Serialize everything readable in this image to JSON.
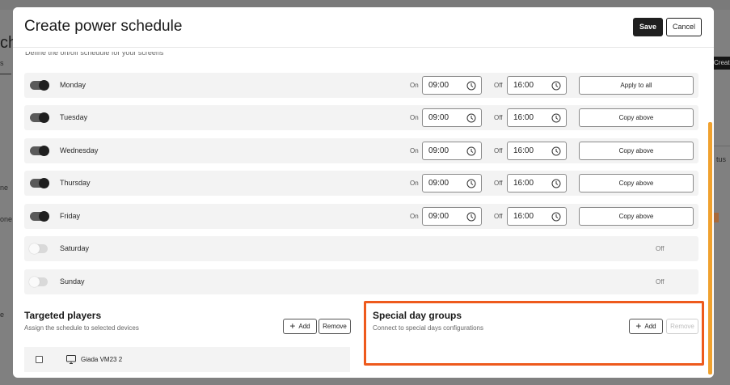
{
  "background": {
    "heading_partial": "ch",
    "create_partial": "Create",
    "status_partial": "tus",
    "row_partial_1": "ne",
    "row_partial_2": "one",
    "row_partial_3": "e",
    "tab_partial": "s"
  },
  "modal": {
    "title": "Create power schedule",
    "save_label": "Save",
    "cancel_label": "Cancel",
    "subtitle": "Define the on/off schedule for your screens"
  },
  "schedule": {
    "on_label": "On",
    "off_label": "Off",
    "days": [
      {
        "name": "Monday",
        "enabled": true,
        "on": "09:00",
        "off": "16:00",
        "action": "Apply to all"
      },
      {
        "name": "Tuesday",
        "enabled": true,
        "on": "09:00",
        "off": "16:00",
        "action": "Copy above"
      },
      {
        "name": "Wednesday",
        "enabled": true,
        "on": "09:00",
        "off": "16:00",
        "action": "Copy above"
      },
      {
        "name": "Thursday",
        "enabled": true,
        "on": "09:00",
        "off": "16:00",
        "action": "Copy above"
      },
      {
        "name": "Friday",
        "enabled": true,
        "on": "09:00",
        "off": "16:00",
        "action": "Copy above"
      },
      {
        "name": "Saturday",
        "enabled": false,
        "status": "Off"
      },
      {
        "name": "Sunday",
        "enabled": false,
        "status": "Off"
      }
    ]
  },
  "targeted_players": {
    "title": "Targeted players",
    "description": "Assign the schedule to selected devices",
    "add_label": "Add",
    "remove_label": "Remove",
    "players": [
      {
        "name": "Giada VM23 2"
      }
    ]
  },
  "special_day_groups": {
    "title": "Special day groups",
    "description": "Connect to special days configurations",
    "add_label": "Add",
    "remove_label": "Remove"
  },
  "colors": {
    "accent": "#ee5a1c",
    "scrollbar": "#f0a12e",
    "primary_button": "#1f1f1f"
  },
  "icons": {
    "time_input": "clock-icon",
    "player": "monitor-icon",
    "add": "plus-icon"
  }
}
